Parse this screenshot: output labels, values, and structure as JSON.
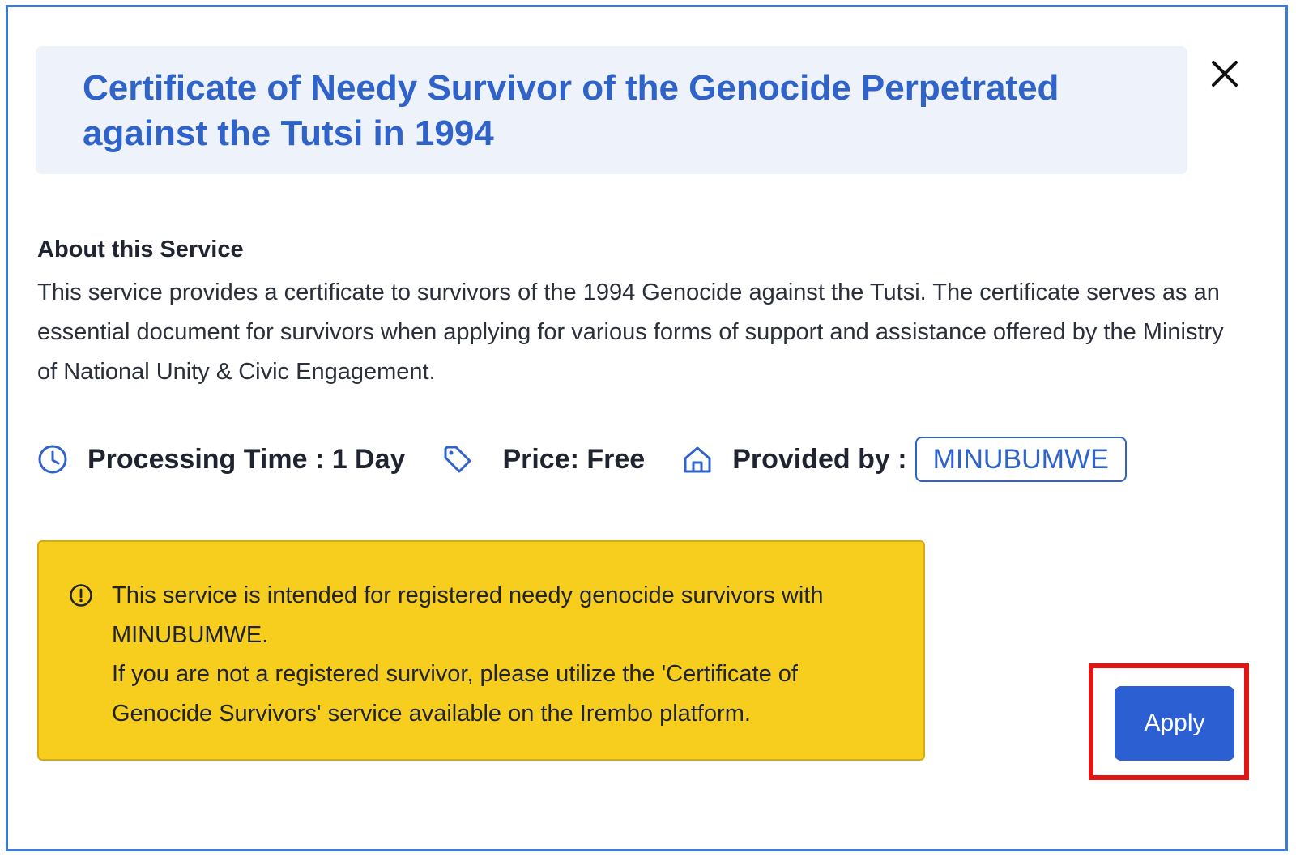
{
  "modal": {
    "title": "Certificate of Needy Survivor of the Genocide Perpetrated against the Tutsi in 1994",
    "close_icon": "close-icon"
  },
  "about": {
    "heading": "About this Service",
    "description": "This service provides a certificate to survivors of the 1994 Genocide against the Tutsi. The certificate serves as an essential document for survivors when applying for various forms of support and assistance offered by the Ministry of National Unity & Civic Engagement."
  },
  "meta": {
    "processing_time": "Processing Time : 1 Day",
    "price": "Price: Free",
    "provided_by_label": "Provided by :",
    "provider": "MINUBUMWE",
    "icons": [
      "clock-icon",
      "price-tag-icon",
      "home-icon"
    ]
  },
  "notice": {
    "line1": "This service is intended for registered needy genocide survivors with MINUBUMWE.",
    "line2": "If you are not a registered survivor, please utilize the 'Certificate of Genocide Survivors' service available on the Irembo platform.",
    "icon": "info-icon"
  },
  "actions": {
    "apply_label": "Apply"
  },
  "colors": {
    "accent": "#2f63c9",
    "header_bg": "#edf2fb",
    "notice_bg": "#f7cd1e",
    "highlight": "#e31414"
  }
}
